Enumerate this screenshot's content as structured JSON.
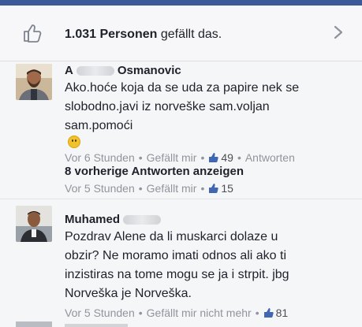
{
  "likes": {
    "count": "1.031 Personen",
    "suffix": "gefällt das."
  },
  "comments": [
    {
      "author_first": "A",
      "author_last": "Osmanovic",
      "lines": [
        "Ako.hoće koja da se uda za papire nek se",
        "slobodno.javi iz norveške sam.voljan",
        "sam.pomoći"
      ],
      "time": "Vor 6 Stunden",
      "like_label": "Gefällt mir",
      "like_count": "49",
      "reply_label": "Antworten"
    },
    {
      "author_first": "Muhamed",
      "author_last": "",
      "lines": [
        "Pozdrav Alene da li muskarci dolaze u",
        "obzir? Ne moramo imati odnos ali ako ti",
        "inzistiras na tome mogu se ja i strpit. jbg",
        "Norveška je Norveška."
      ],
      "time": "Vor 5 Stunden",
      "like_label": "Gefällt mir nicht mehr",
      "like_count": "81"
    }
  ],
  "previous_replies": {
    "label": "8 vorherige Antworten anzeigen",
    "time": "Vor 5 Stunden",
    "like_label": "Gefällt mir",
    "like_count": "15"
  },
  "separator": "•",
  "colors": {
    "brand": "#3b5998",
    "like_blue": "#4267b2",
    "meta_gray": "#90949c"
  },
  "icons": {
    "like": "thumbs-up-icon",
    "chevron": "chevron-right-icon"
  }
}
